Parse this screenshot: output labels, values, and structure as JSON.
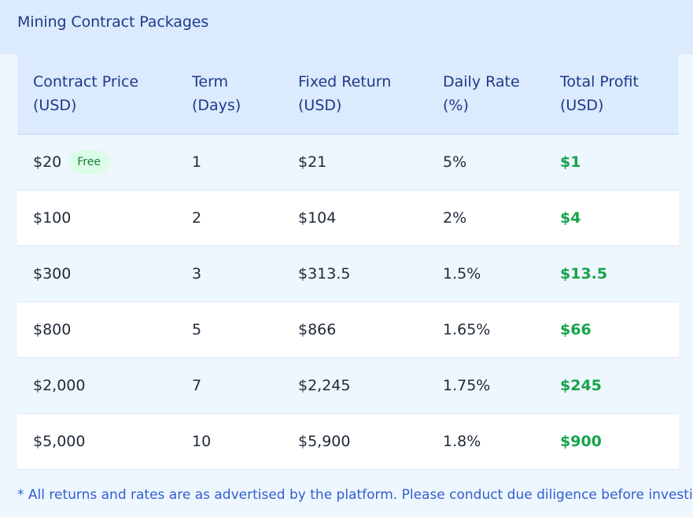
{
  "title": "Mining Contract Packages",
  "columns": [
    {
      "line1": "Contract Price",
      "line2": "(USD)"
    },
    {
      "line1": "Term",
      "line2": "(Days)"
    },
    {
      "line1": "Fixed Return",
      "line2": "(USD)"
    },
    {
      "line1": "Daily Rate",
      "line2": "(%)"
    },
    {
      "line1": "Total Profit",
      "line2": "(USD)"
    }
  ],
  "rows": [
    {
      "price": "$20",
      "badge": "Free",
      "term": "1",
      "return": "$21",
      "rate": "5%",
      "profit": "$1"
    },
    {
      "price": "$100",
      "term": "2",
      "return": "$104",
      "rate": "2%",
      "profit": "$4"
    },
    {
      "price": "$300",
      "term": "3",
      "return": "$313.5",
      "rate": "1.5%",
      "profit": "$13.5"
    },
    {
      "price": "$800",
      "term": "5",
      "return": "$866",
      "rate": "1.65%",
      "profit": "$66"
    },
    {
      "price": "$2,000",
      "term": "7",
      "return": "$2,245",
      "rate": "1.75%",
      "profit": "$245"
    },
    {
      "price": "$5,000",
      "term": "10",
      "return": "$5,900",
      "rate": "1.8%",
      "profit": "$900"
    }
  ],
  "footnote": "* All returns and rates are as advertised by the platform. Please conduct due diligence before investing.",
  "colors": {
    "header_bg": "#dbeafd",
    "title_text": "#1e3a8a",
    "profit_text": "#16a34a",
    "badge_bg": "#dcfce7",
    "footnote_text": "#2f5fcf"
  }
}
